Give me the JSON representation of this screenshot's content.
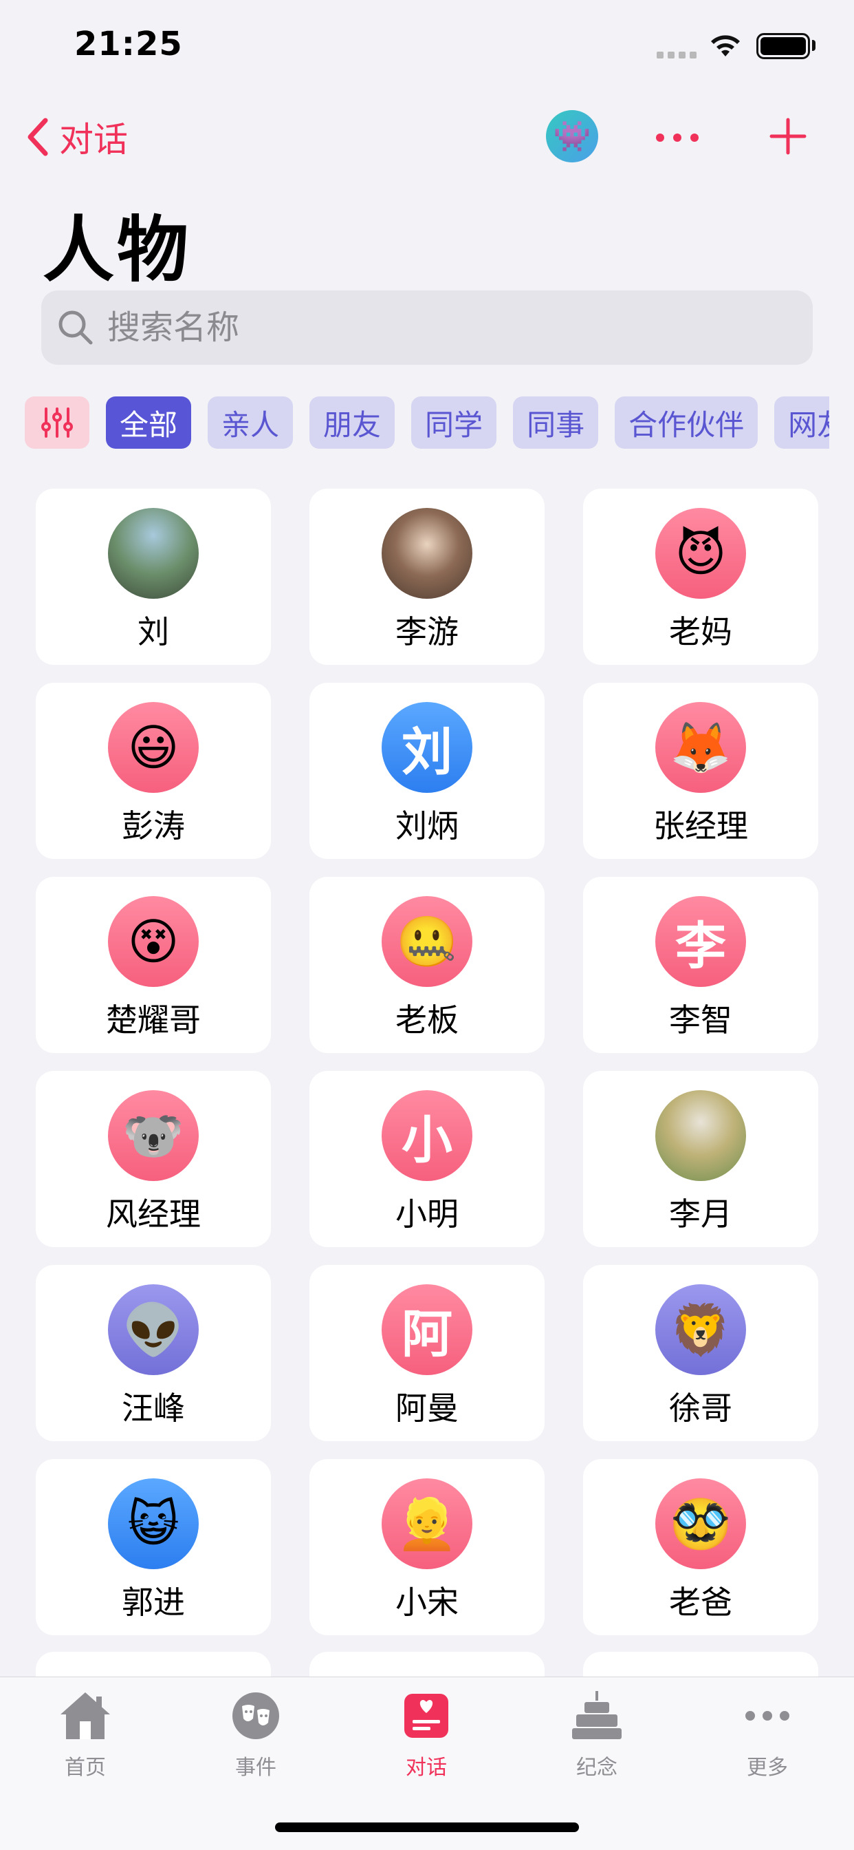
{
  "status_bar": {
    "time": "21:25"
  },
  "nav": {
    "back_label": "对话",
    "avatar_emoji": "👾",
    "accent_color": "#f0325a"
  },
  "page": {
    "title": "人物"
  },
  "search": {
    "placeholder": "搜索名称"
  },
  "filters": {
    "settings_icon": "sliders-icon",
    "chips": [
      "全部",
      "亲人",
      "朋友",
      "同学",
      "同事",
      "合作伙伴",
      "网友"
    ],
    "active_index": 0,
    "active_color": "#5856d6"
  },
  "people": [
    {
      "name": "刘",
      "avatar_type": "photo",
      "avatar": ""
    },
    {
      "name": "李游",
      "avatar_type": "photo",
      "avatar": ""
    },
    {
      "name": "老妈",
      "avatar_type": "emoji",
      "avatar": "😈"
    },
    {
      "name": "彭涛",
      "avatar_type": "emoji",
      "avatar": "😃"
    },
    {
      "name": "刘炳",
      "avatar_type": "letter",
      "avatar": "刘"
    },
    {
      "name": "张经理",
      "avatar_type": "emoji",
      "avatar": "🦊"
    },
    {
      "name": "楚耀哥",
      "avatar_type": "emoji",
      "avatar": "😵"
    },
    {
      "name": "老板",
      "avatar_type": "emoji",
      "avatar": "🤐"
    },
    {
      "name": "李智",
      "avatar_type": "letter",
      "avatar": "李"
    },
    {
      "name": "风经理",
      "avatar_type": "emoji",
      "avatar": "🐨"
    },
    {
      "name": "小明",
      "avatar_type": "letter",
      "avatar": "小"
    },
    {
      "name": "李月",
      "avatar_type": "photo",
      "avatar": ""
    },
    {
      "name": "汪峰",
      "avatar_type": "emoji",
      "avatar": "👽"
    },
    {
      "name": "阿曼",
      "avatar_type": "letter",
      "avatar": "阿"
    },
    {
      "name": "徐哥",
      "avatar_type": "emoji",
      "avatar": "🦁"
    },
    {
      "name": "郭进",
      "avatar_type": "emoji",
      "avatar": "😺"
    },
    {
      "name": "小宋",
      "avatar_type": "emoji",
      "avatar": "👱"
    },
    {
      "name": "老爸",
      "avatar_type": "emoji",
      "avatar": "🥸"
    }
  ],
  "tabs": [
    {
      "label": "首页",
      "icon": "house-icon"
    },
    {
      "label": "事件",
      "icon": "theater-masks-icon"
    },
    {
      "label": "对话",
      "icon": "chat-heart-icon",
      "active": true
    },
    {
      "label": "纪念",
      "icon": "cake-icon"
    },
    {
      "label": "更多",
      "icon": "ellipsis-icon"
    }
  ]
}
